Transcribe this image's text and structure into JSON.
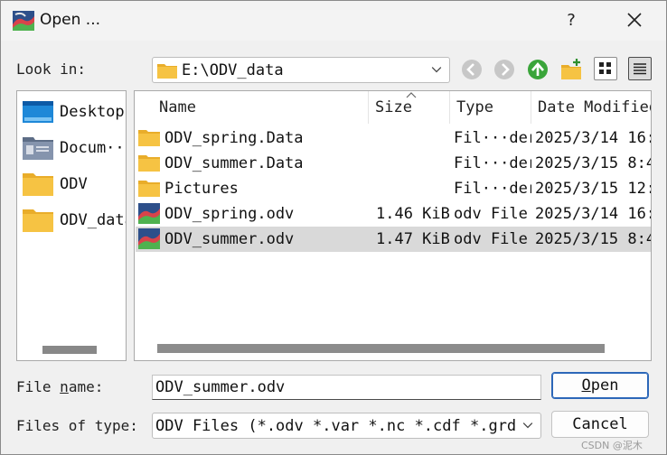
{
  "window": {
    "title": "Open ..."
  },
  "titlebar": {
    "help": "?"
  },
  "look_in": {
    "label": "Look in:",
    "path": "E:\\ODV_data"
  },
  "sidebar": {
    "items": [
      {
        "label": "Desktop"
      },
      {
        "label": "Docum···"
      },
      {
        "label": "ODV"
      },
      {
        "label": "ODV_data"
      }
    ]
  },
  "filelist": {
    "columns": {
      "name": "Name",
      "size": "Size",
      "type": "Type",
      "date": "Date Modified"
    },
    "rows": [
      {
        "name": "ODV_spring.Data",
        "size": "",
        "type": "Fil···der",
        "date": "2025/3/14 16:",
        "kind": "folder"
      },
      {
        "name": "ODV_summer.Data",
        "size": "",
        "type": "Fil···der",
        "date": "2025/3/15 8:4",
        "kind": "folder"
      },
      {
        "name": "Pictures",
        "size": "",
        "type": "Fil···der",
        "date": "2025/3/15 12:",
        "kind": "folder"
      },
      {
        "name": "ODV_spring.odv",
        "size": "1.46 KiB",
        "type": "odv File",
        "date": "2025/3/14 16:",
        "kind": "odv"
      },
      {
        "name": "ODV_summer.odv",
        "size": "1.47 KiB",
        "type": "odv File",
        "date": "2025/3/15 8:4",
        "kind": "odv",
        "selected": true
      }
    ]
  },
  "file_name": {
    "label_pre": "File ",
    "label_u": "n",
    "label_post": "ame:",
    "value": "ODV_summer.odv"
  },
  "file_type": {
    "label": "Files of type:",
    "value": "ODV Files (*.odv *.var *.nc *.cdf *.grd)"
  },
  "buttons": {
    "open_u": "O",
    "open_rest": "pen",
    "cancel": "Cancel"
  },
  "watermark": "CSDN @泥木",
  "colors": {
    "accent": "#2c67b8",
    "folder": "#f6c343",
    "selection": "#d9d9d9",
    "nav_green": "#3aa53a"
  }
}
